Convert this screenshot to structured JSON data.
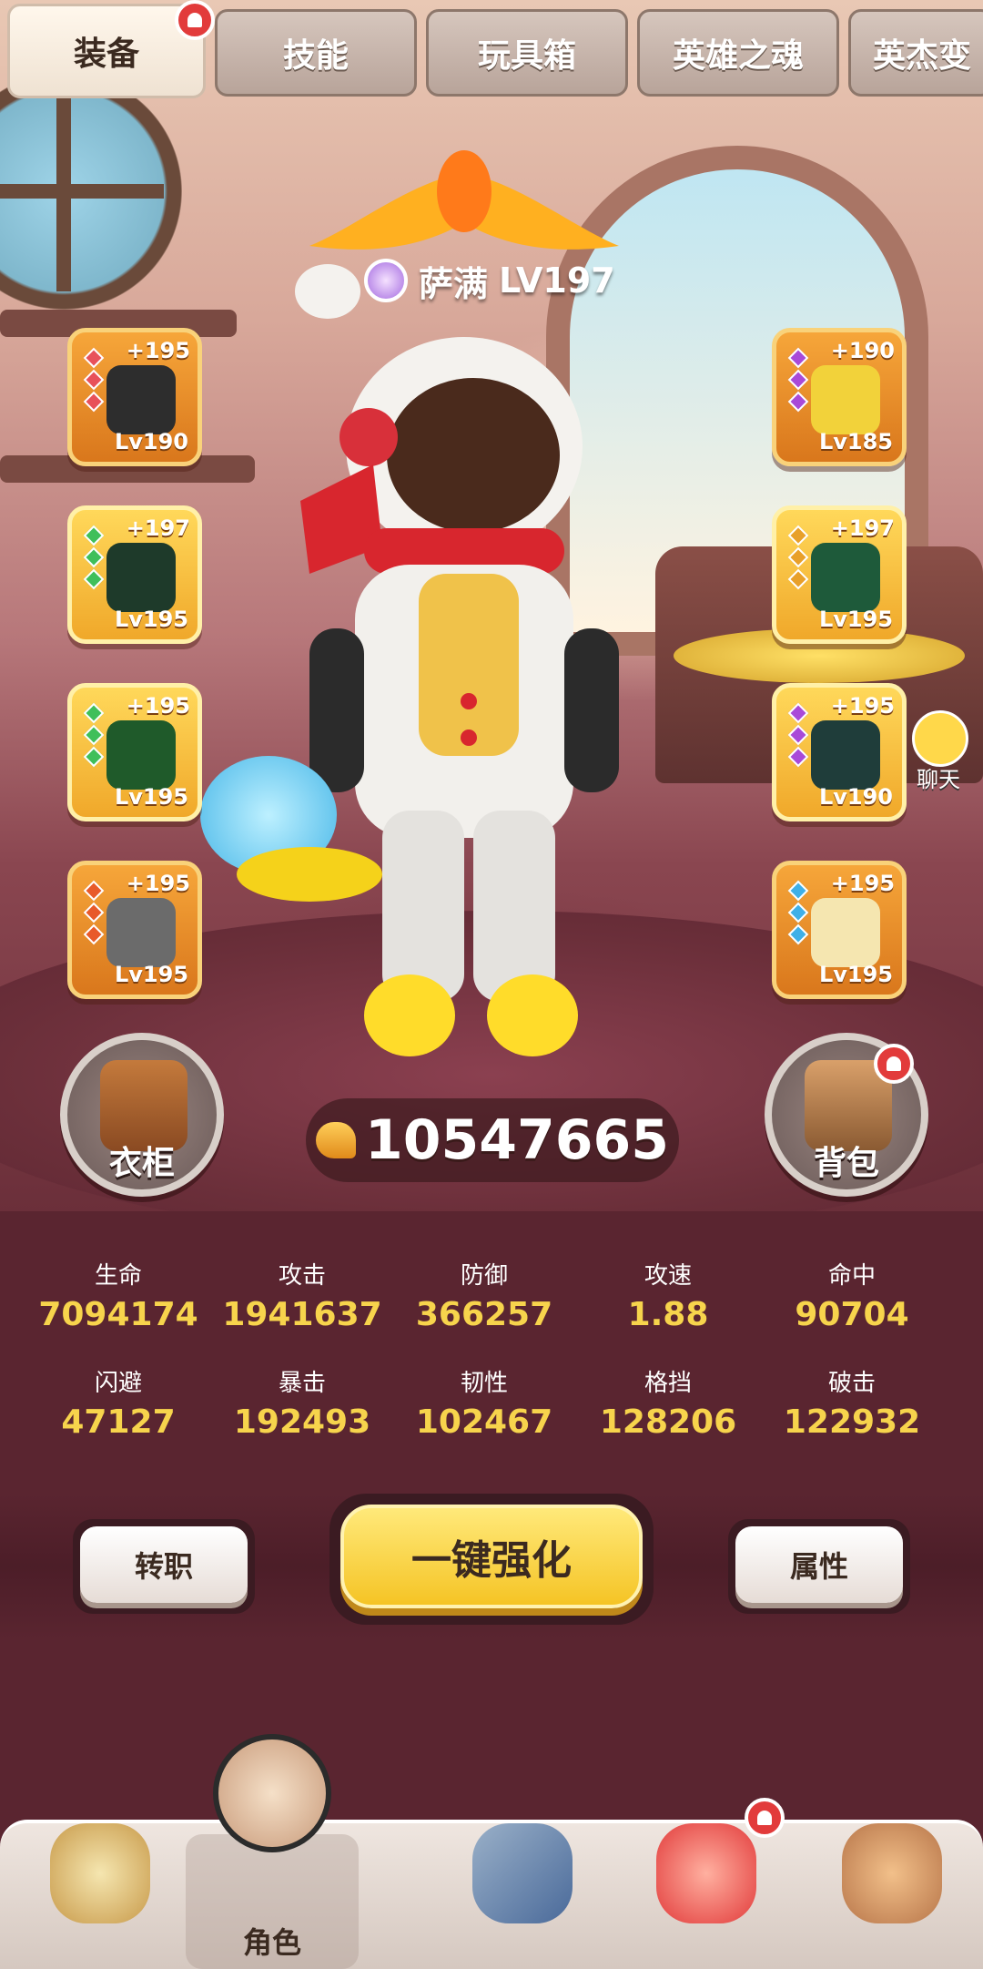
{
  "tabs": [
    {
      "label": "装备",
      "active": true,
      "notification": true
    },
    {
      "label": "技能",
      "active": false
    },
    {
      "label": "玩具箱",
      "active": false
    },
    {
      "label": "英雄之魂",
      "active": false
    },
    {
      "label": "英杰变",
      "active": false
    }
  ],
  "hero": {
    "name": "萨满",
    "level": "LV197"
  },
  "equipment_left": [
    {
      "plus": "+195",
      "level": "Lv190",
      "gem_color": "#e8515a",
      "item_color": "#2d2d2d"
    },
    {
      "plus": "+197",
      "level": "Lv195",
      "gem_color": "#3fbf5a",
      "item_color": "#1e3a2a"
    },
    {
      "plus": "+195",
      "level": "Lv195",
      "gem_color": "#3fbf5a",
      "item_color": "#1f5a2a"
    },
    {
      "plus": "+195",
      "level": "Lv195",
      "gem_color": "#e85a2a",
      "item_color": "#6b6b6b"
    }
  ],
  "equipment_right": [
    {
      "plus": "+190",
      "level": "Lv185",
      "gem_color": "#a94ad8",
      "item_color": "#f2d23a"
    },
    {
      "plus": "+197",
      "level": "Lv195",
      "gem_color": "#e8a02a",
      "item_color": "#1e5a3a"
    },
    {
      "plus": "+195",
      "level": "Lv190",
      "gem_color": "#a94ad8",
      "item_color": "#1f3d3a"
    },
    {
      "plus": "+195",
      "level": "Lv195",
      "gem_color": "#3fb0e8",
      "item_color": "#f5e6b0"
    }
  ],
  "wardrobe_label": "衣柜",
  "backpack_label": "背包",
  "combat_power": "10547665",
  "chat_label": "聊天",
  "stats": [
    {
      "label": "生命",
      "value": "7094174"
    },
    {
      "label": "攻击",
      "value": "1941637"
    },
    {
      "label": "防御",
      "value": "366257"
    },
    {
      "label": "攻速",
      "value": "1.88"
    },
    {
      "label": "命中",
      "value": "90704"
    },
    {
      "label": "闪避",
      "value": "47127"
    },
    {
      "label": "暴击",
      "value": "192493"
    },
    {
      "label": "韧性",
      "value": "102467"
    },
    {
      "label": "格挡",
      "value": "128206"
    },
    {
      "label": "破击",
      "value": "122932"
    }
  ],
  "actions": {
    "job_change": "转职",
    "one_click_enhance": "一键强化",
    "attributes": "属性"
  },
  "bottom_nav": [
    {
      "label": "",
      "icon": "yeti-icon",
      "active": false
    },
    {
      "label": "角色",
      "icon": "shaman-avatar-icon",
      "active": true
    },
    {
      "label": "",
      "icon": "weapons-icon",
      "active": false
    },
    {
      "label": "",
      "icon": "dragon-pet-icon",
      "active": false,
      "notification": true
    },
    {
      "label": "",
      "icon": "totem-icon",
      "active": false
    }
  ],
  "colors": {
    "accent_gold": "#f7d44c",
    "slot_orange": "#f6a63a",
    "notification_red": "#e23b3b"
  }
}
